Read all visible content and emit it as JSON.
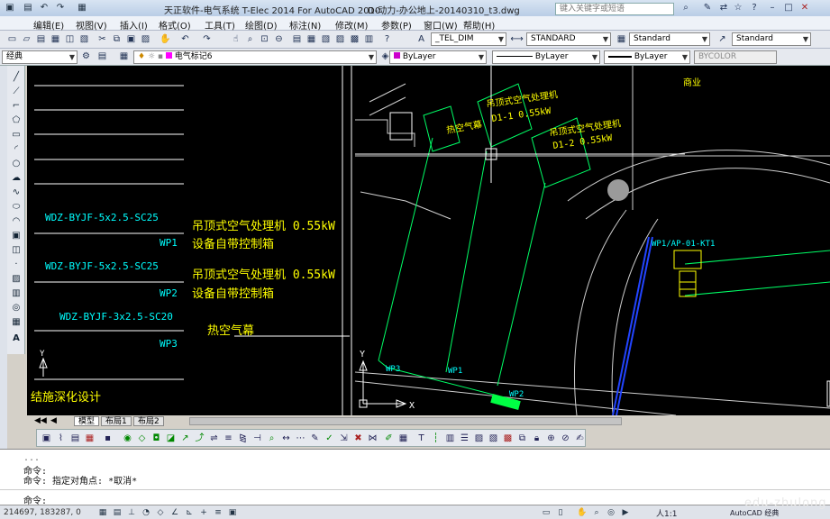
{
  "window": {
    "title": "天正软件-电气系统 T-Elec 2014  For AutoCAD 2010",
    "file": "D-动力-办公地上-20140310_t3.dwg",
    "search_placeholder": "键入关键字或短语"
  },
  "menu": [
    "编辑(E)",
    "视图(V)",
    "插入(I)",
    "格式(O)",
    "工具(T)",
    "绘图(D)",
    "标注(N)",
    "修改(M)",
    "参数(P)",
    "窗口(W)",
    "帮助(H)"
  ],
  "toolbar1": {
    "dimstyle": "_TEL_DIM",
    "textstyle": "STANDARD",
    "tablestyle": "Standard",
    "mleaderstyle": "Standard"
  },
  "toolbar2": {
    "workspace": "经典",
    "layer": "电气标记6",
    "color": "ByLayer",
    "linetype": "ByLayer",
    "lineweight": "ByLayer",
    "plotstyle": "BYCOLOR"
  },
  "drawing": {
    "circuits": [
      {
        "cable": "WDZ-BYJF-5x2.5-SC25",
        "id": "WP1",
        "desc1": "吊顶式空气处理机 0.55kW",
        "desc2": "设备自带控制箱"
      },
      {
        "cable": "WDZ-BYJF-5x2.5-SC25",
        "id": "WP2",
        "desc1": "吊顶式空气处理机 0.55kW",
        "desc2": "设备自带控制箱"
      },
      {
        "cable": "WDZ-BYJF-3x2.5-SC20",
        "id": "WP3",
        "desc1": "热空气幕",
        "desc2": ""
      }
    ],
    "bottom_left_text": "结施深化设计",
    "plan_labels": {
      "unit1_title": "吊顶式空气处理机",
      "unit1_sub": "D1-1  0.55kW",
      "unit2_title": "吊顶式空气处理机",
      "unit2_sub": "D1-2  0.55kW",
      "heat_curtain": "热空气幕",
      "room": "商业",
      "panel": "WP1/AP-01-KT1",
      "wp3": "WP3",
      "wp1": "WP1",
      "wp2": "WP2",
      "axis_x": "X",
      "axis_y": "Y"
    }
  },
  "layout_tabs": [
    "模型",
    "布局1",
    "布局2"
  ],
  "command": {
    "line1": "命令:",
    "line2": "命令: 指定对角点: *取消*",
    "prompt": "命令:"
  },
  "status": {
    "coords": "214697, 183287, 0",
    "scale": "1:1",
    "workspace": "AutoCAD 经典"
  },
  "watermark": "edu-zhulong"
}
